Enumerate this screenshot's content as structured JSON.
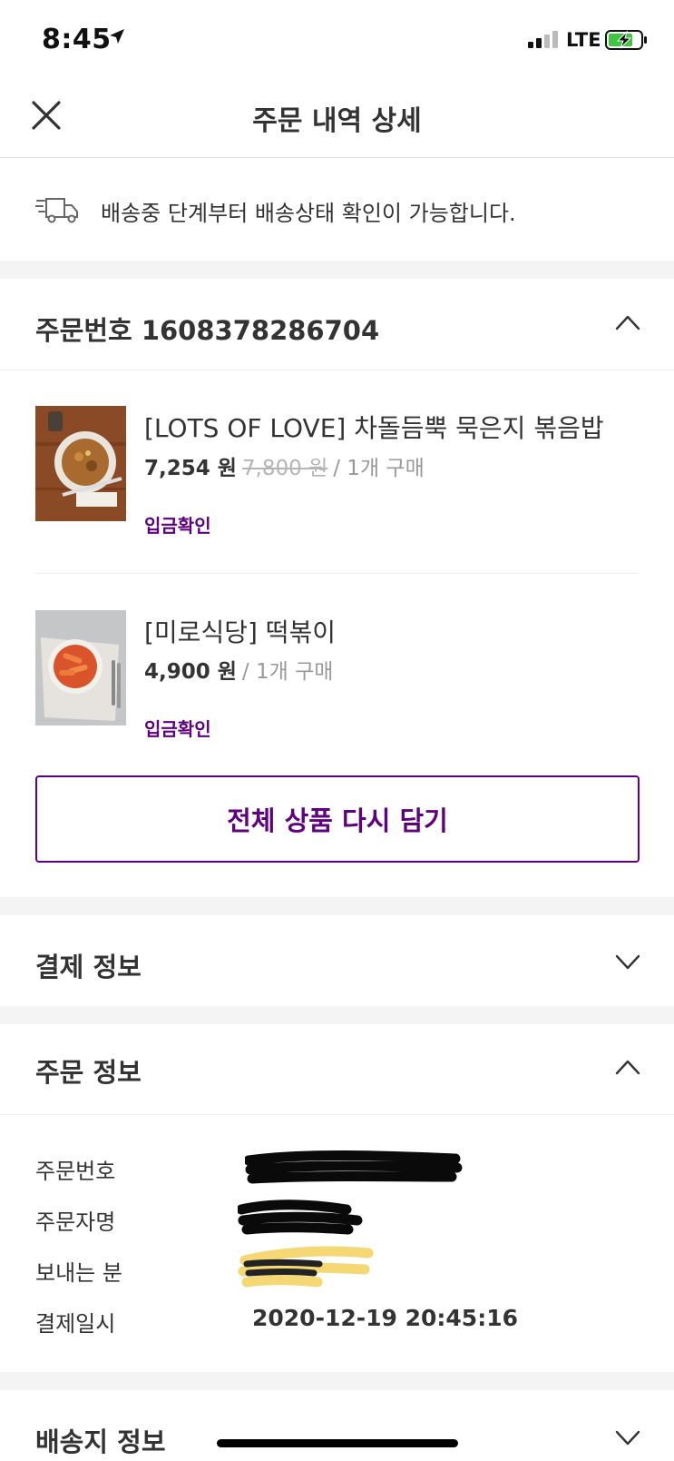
{
  "status_bar": {
    "time": "8:45",
    "network": "LTE"
  },
  "header": {
    "title": "주문 내역 상세"
  },
  "notice": {
    "text": "배송중 단계부터 배송상태 확인이 가능합니다."
  },
  "order_section": {
    "title": "주문번호 1608378286704",
    "items": [
      {
        "name": "[LOTS OF LOVE] 차돌듬뿍 묵은지 볶음밥",
        "price": "7,254 원",
        "original_price": "7,800 원",
        "quantity": "/ 1개 구매",
        "status": "입금확인"
      },
      {
        "name": "[미로식당] 떡볶이",
        "price": "4,900 원",
        "original_price": "",
        "quantity": "/ 1개 구매",
        "status": "입금확인"
      }
    ],
    "re_add_button": "전체 상품 다시 담기"
  },
  "payment_section": {
    "title": "결제 정보"
  },
  "order_info_section": {
    "title": "주문 정보",
    "rows": [
      {
        "label": "주문번호",
        "value": ""
      },
      {
        "label": "주문자명",
        "value": ""
      },
      {
        "label": "보내는 분",
        "value": ""
      },
      {
        "label": "결제일시",
        "value": "2020-12-19 20:45:16"
      }
    ]
  },
  "shipping_section": {
    "title": "배송지 정보"
  },
  "colors": {
    "brand": "#5f0080",
    "text": "#333333",
    "muted": "#999999",
    "separator": "#f4f4f4"
  }
}
